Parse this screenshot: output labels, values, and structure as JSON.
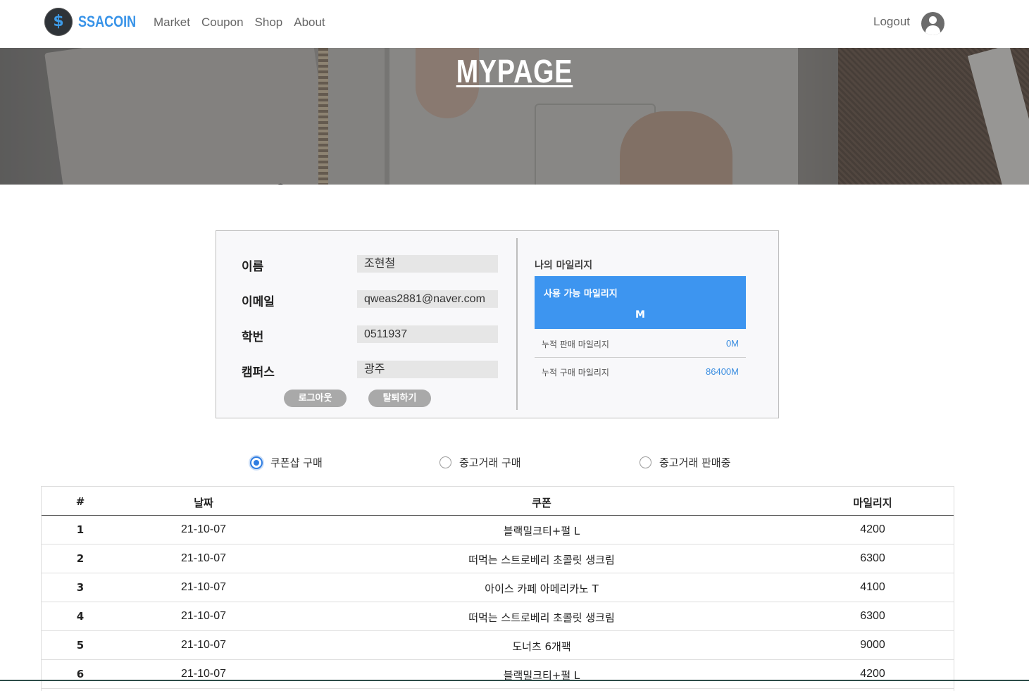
{
  "brand": {
    "name": "SSACOIN",
    "logo_glyph": "$",
    "accent": "#3893e8"
  },
  "nav": {
    "items": [
      "Market",
      "Coupon",
      "Shop",
      "About"
    ],
    "logout_label": "Logout"
  },
  "hero": {
    "title": "MYPAGE"
  },
  "profile": {
    "fields": [
      {
        "label": "이름",
        "value": "조현철"
      },
      {
        "label": "이메일",
        "value": "qweas2881@naver.com"
      },
      {
        "label": "학번",
        "value": "0511937"
      },
      {
        "label": "캠퍼스",
        "value": "광주"
      }
    ],
    "logout_button": "로그아웃",
    "withdraw_button": "탈퇴하기"
  },
  "mileage": {
    "title": "나의 마일리지",
    "available_label": "사용 가능 마일리지",
    "available_value": "M",
    "sold_label": "누적 판매 마일리지",
    "sold_value": "0M",
    "bought_label": "누적 구매 마일리지",
    "bought_value": "86400M"
  },
  "filters": {
    "options": [
      "쿠폰샵 구매",
      "중고거래 구매",
      "중고거래 판매중"
    ],
    "selected": "쿠폰샵 구매"
  },
  "table": {
    "headers": [
      "#",
      "날짜",
      "쿠폰",
      "마일리지"
    ],
    "rows": [
      {
        "idx": "1",
        "date": "21-10-07",
        "coupon": "블랙밀크티+펄 L",
        "mileage": "4200"
      },
      {
        "idx": "2",
        "date": "21-10-07",
        "coupon": "떠먹는 스트로베리 초콜릿 생크림",
        "mileage": "6300"
      },
      {
        "idx": "3",
        "date": "21-10-07",
        "coupon": "아이스 카페 아메리카노 T",
        "mileage": "4100"
      },
      {
        "idx": "4",
        "date": "21-10-07",
        "coupon": "떠먹는 스트로베리 초콜릿 생크림",
        "mileage": "6300"
      },
      {
        "idx": "5",
        "date": "21-10-07",
        "coupon": "도너츠 6개팩",
        "mileage": "9000"
      },
      {
        "idx": "6",
        "date": "21-10-07",
        "coupon": "블랙밀크티+펄 L",
        "mileage": "4200"
      }
    ]
  }
}
